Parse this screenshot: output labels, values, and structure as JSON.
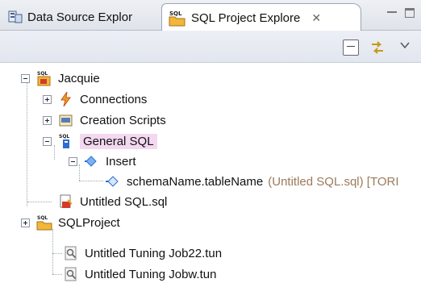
{
  "tabs": [
    {
      "label": "Data Source Explor",
      "icon": "data-source-icon"
    },
    {
      "label": "SQL Project Explore",
      "icon": "sql-project-icon"
    }
  ],
  "tree": {
    "jacquie": "Jacquie",
    "connections": "Connections",
    "creation_scripts": "Creation Scripts",
    "general_sql": "General SQL",
    "insert": "Insert",
    "schema_table": "schemaName.tableName",
    "schema_table_decoration": "(Untitled SQL.sql) [TORI",
    "untitled_sql": "Untitled SQL.sql",
    "sqlproject": "SQLProject",
    "tuning_job22": "Untitled Tuning Job22.tun",
    "tuning_jobw": "Untitled Tuning Jobw.tun"
  },
  "icon_text": {
    "sql": "SQL"
  },
  "colors": {
    "accent": "#f0a020",
    "selection": "#f3d8f0",
    "sql_blue": "#2a6fd0"
  }
}
